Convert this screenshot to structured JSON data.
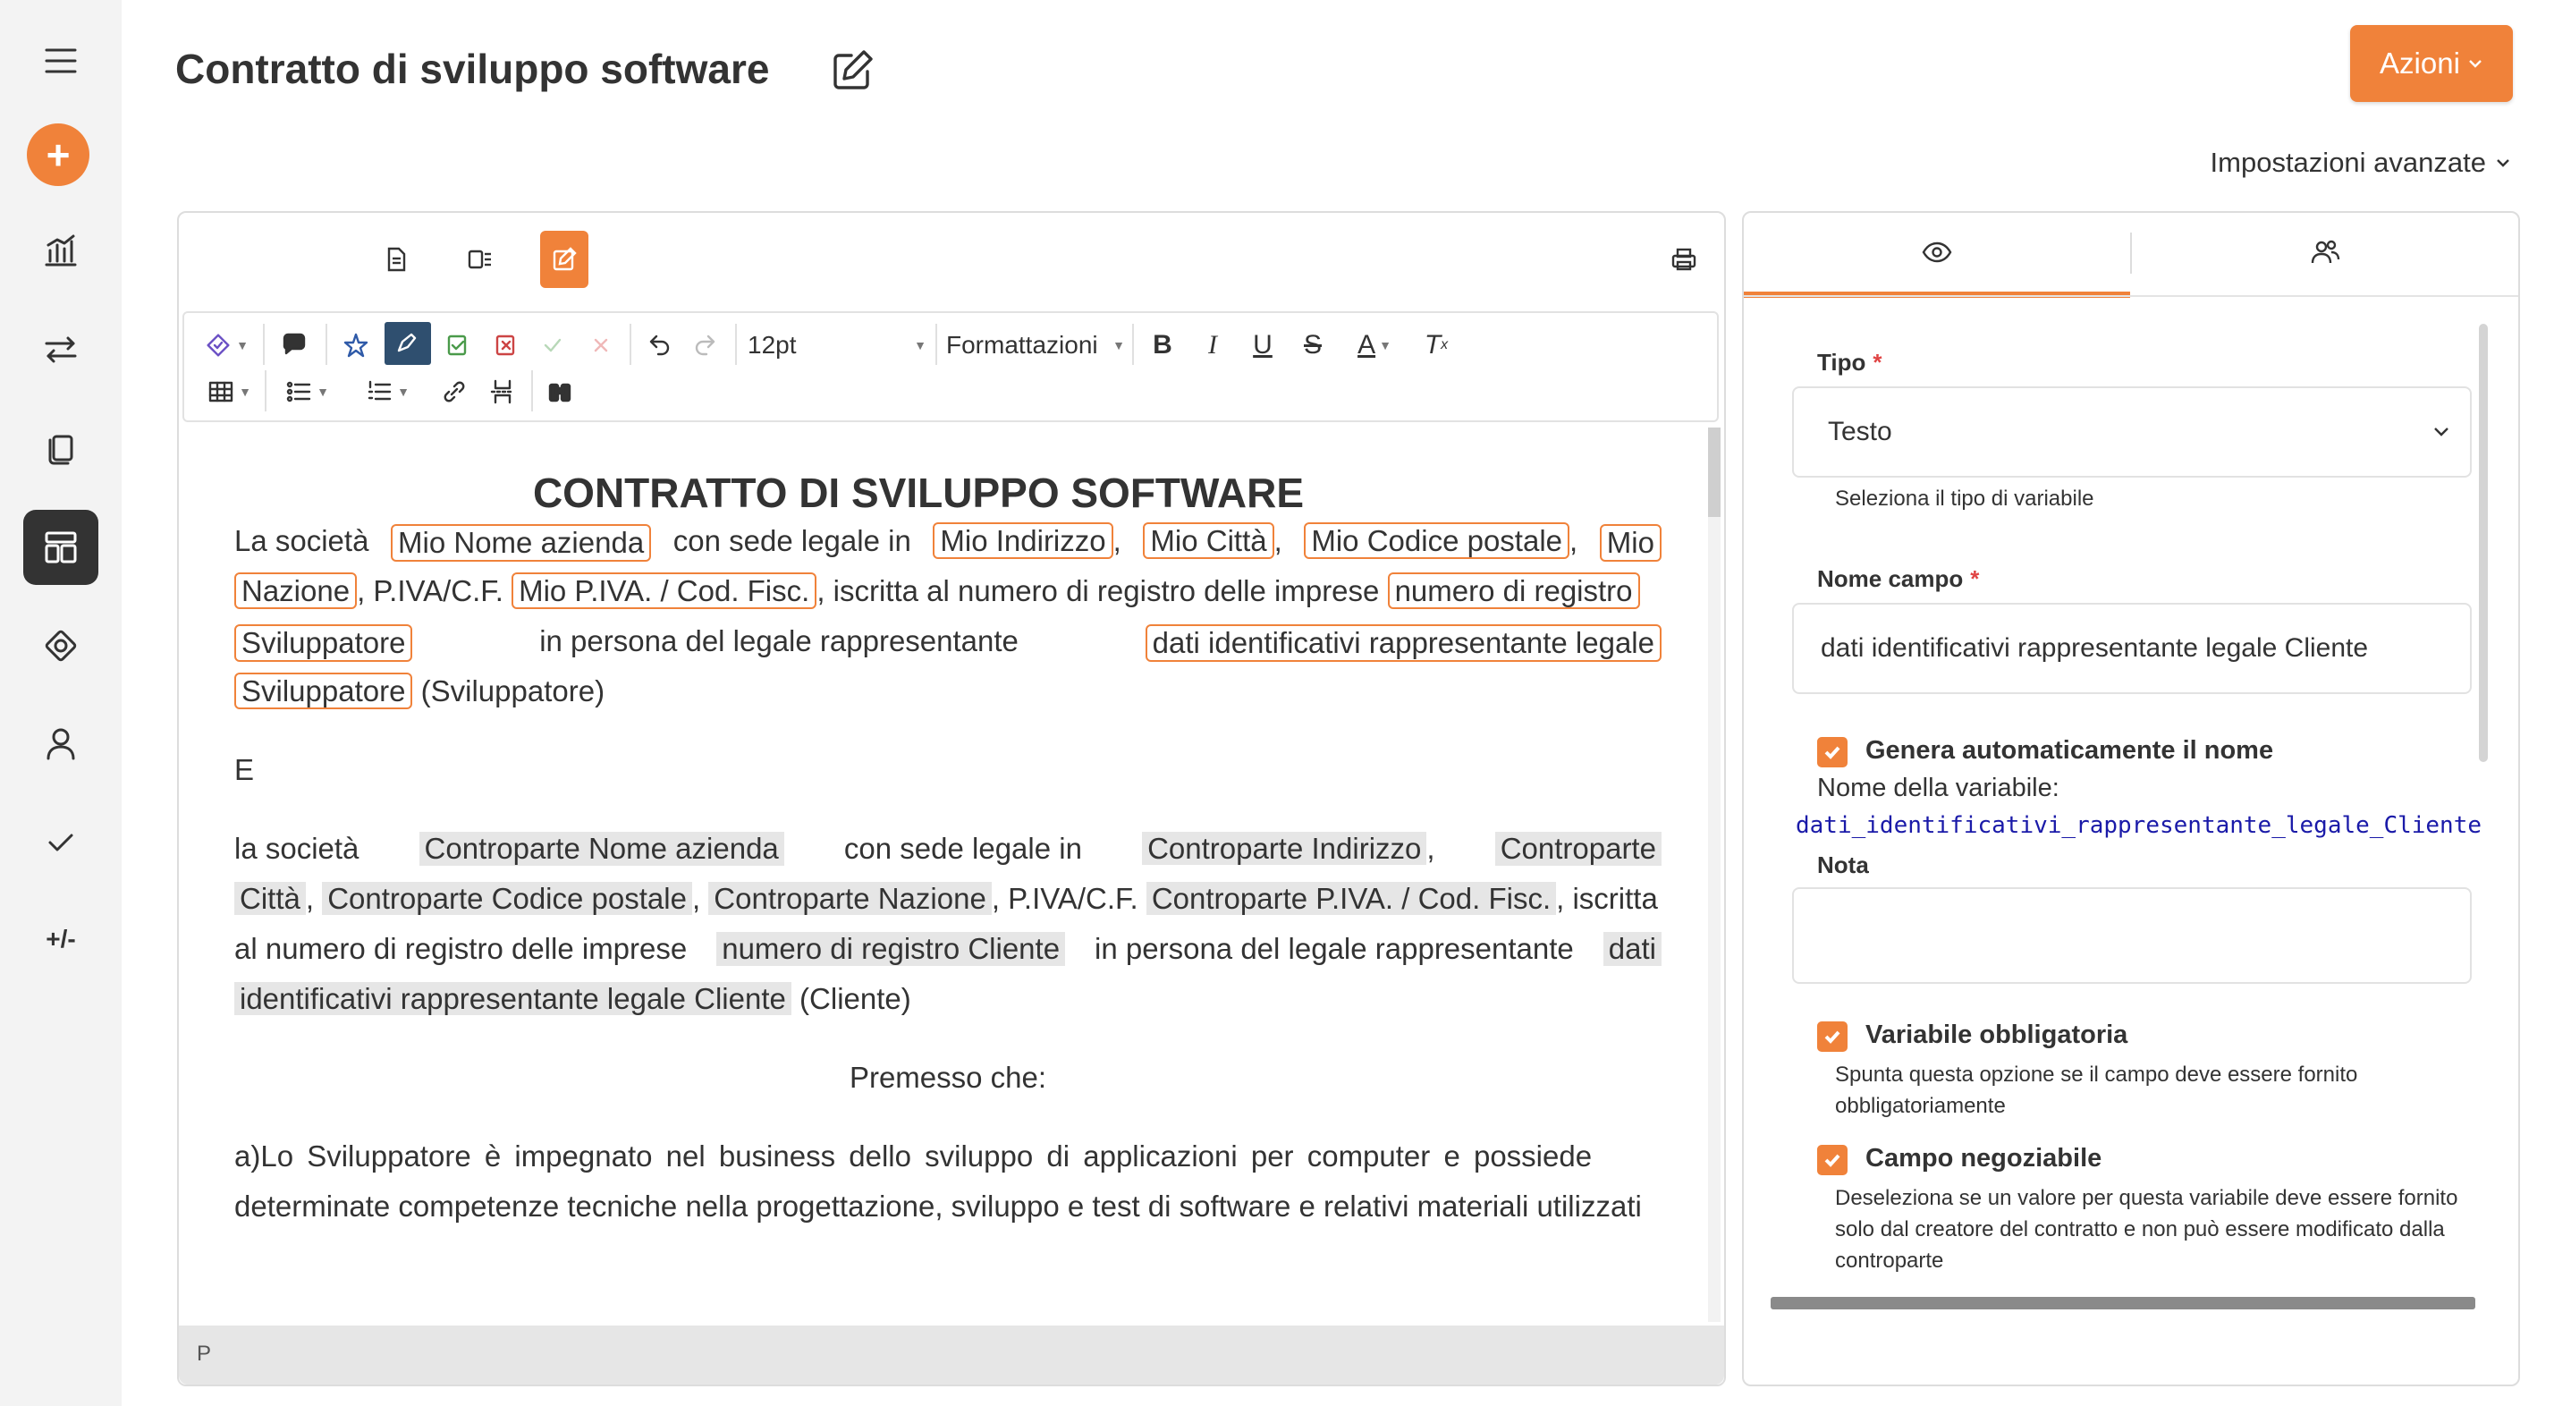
{
  "header": {
    "title": "Contratto di sviluppo software",
    "actions_label": "Azioni",
    "advanced_settings_label": "Impostazioni avanzate"
  },
  "rail": {
    "items": [
      "menu-icon",
      "add-icon",
      "chart-icon",
      "transfer-icon",
      "copy-icon",
      "dashboard-icon",
      "lifebuoy-icon",
      "user-icon",
      "check-icon"
    ],
    "text_item": "+/-",
    "add_symbol": "+"
  },
  "toolbar": {
    "font_size": "12pt",
    "format_label": "Formattazioni"
  },
  "document": {
    "heading": "CONTRATTO DI SVILUPPO SOFTWARE",
    "p1": {
      "t1": "La società",
      "ph1": "Mio Nome azienda",
      "t2": "con sede legale in",
      "ph2": "Mio Indirizzo",
      "ph3": "Mio Città",
      "ph4": "Mio Codice postale",
      "ph5a": "Mio",
      "ph5b": "Nazione",
      "t3": ", P.IVA/C.F.",
      "ph6": "Mio P.IVA. / Cod. Fisc.",
      "t4": ", iscritta al numero di registro delle imprese",
      "ph7a": "numero di registro",
      "ph7b": "Sviluppatore",
      "t5": "in persona del legale rappresentante",
      "ph8a": "dati identificativi rappresentante legale",
      "ph8b": "Sviluppatore",
      "t6": "(Sviluppatore)"
    },
    "conj": "E",
    "p2": {
      "t1": "la società",
      "ph1": "Controparte Nome azienda",
      "t2": "con sede legale in",
      "ph2": "Controparte Indirizzo",
      "ph3a": "Controparte",
      "ph3b": "Città",
      "ph4": "Controparte Codice postale",
      "ph5": "Controparte Nazione",
      "t3": ", P.IVA/C.F.",
      "ph6": "Controparte P.IVA. / Cod. Fisc.",
      "t4": ", iscritta",
      "t5": "al numero di registro delle imprese",
      "ph7": "numero di registro Cliente",
      "t6": "in persona del legale rappresentante",
      "ph8a": "dati",
      "ph8b": "identificativi rappresentante legale Cliente",
      "t7": "(Cliente)"
    },
    "premise": "Premesso che:",
    "p3_line1": "a)Lo Sviluppatore è impegnato nel business dello sviluppo di applicazioni per computer e possiede",
    "p3_line2": "determinate competenze tecniche nella progettazione, sviluppo e test di software e relativi materiali utilizzati",
    "status_path": "P"
  },
  "side": {
    "tipo_label": "Tipo",
    "tipo_value": "Testo",
    "tipo_help": "Seleziona il tipo di variabile",
    "nome_label": "Nome campo",
    "nome_value": "dati identificativi rappresentante legale Cliente",
    "auto_label": "Genera automaticamente il nome",
    "var_name_label": "Nome della variabile:",
    "var_name_value": "dati_identificativi_rappresentante_legale_Cliente",
    "nota_label": "Nota",
    "nota_value": "",
    "obbl_label": "Variabile obbligatoria",
    "obbl_help": "Spunta questa opzione se il campo deve essere fornito obbligatoriamente",
    "neg_label": "Campo negoziabile",
    "neg_help": "Deseleziona se un valore per questa variabile deve essere fornito solo dal creatore del contratto e non può essere modificato dalla controparte",
    "required_mark": "*"
  },
  "colors": {
    "accent": "#f0823a",
    "active_rail": "#333333",
    "placeholder_gray": "#e6e6e6"
  }
}
